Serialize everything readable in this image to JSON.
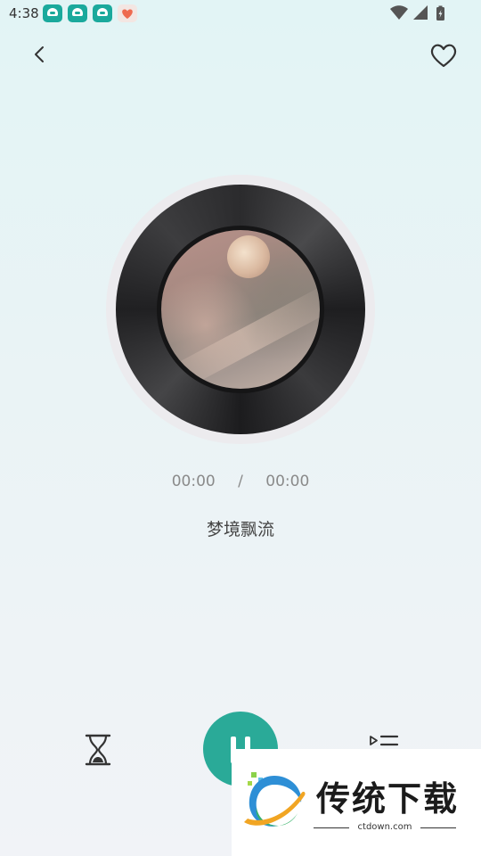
{
  "status_bar": {
    "time": "4:38",
    "icons": [
      "app-notification-icon",
      "app-notification-icon",
      "app-notification-icon",
      "heart-app-icon",
      "wifi-icon",
      "signal-icon",
      "battery-charging-icon"
    ]
  },
  "nav": {
    "back_icon": "chevron-left-icon",
    "favorite_icon": "heart-outline-icon"
  },
  "player": {
    "current_time": "00:00",
    "separator": "/",
    "total_time": "00:00",
    "track_title": "梦境飘流"
  },
  "controls": {
    "timer_icon": "hourglass-icon",
    "play_pause_icon": "pause-icon",
    "playlist_icon": "playlist-icon"
  },
  "colors": {
    "accent": "#2aaa98",
    "status_icon_bg": "#1aa99c"
  },
  "watermark": {
    "brand": "传统下载",
    "url": "ctdown.com"
  }
}
